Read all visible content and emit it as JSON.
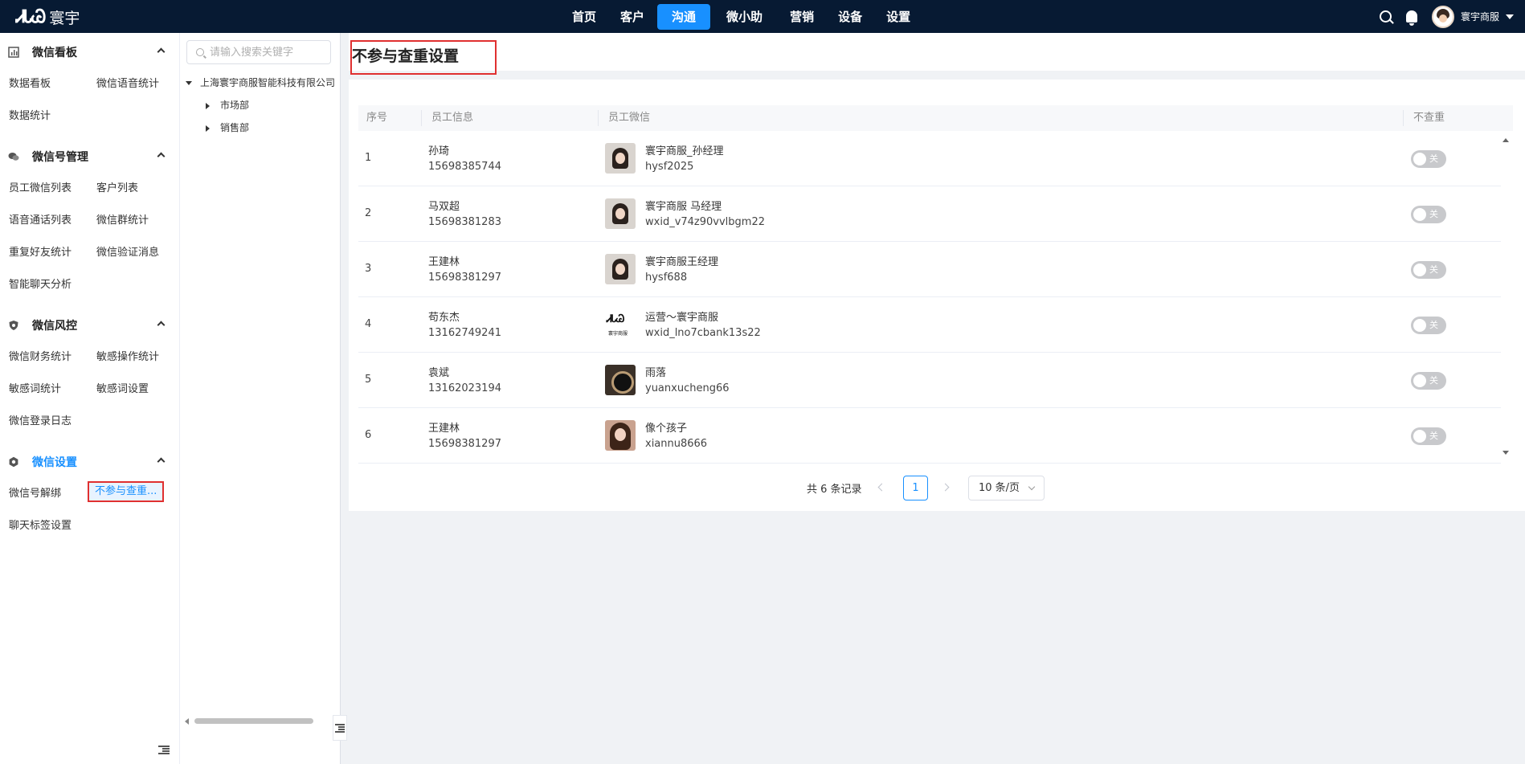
{
  "brand": {
    "mark": "ᏗᏓᏊ",
    "name": "寰宇"
  },
  "nav": [
    "首页",
    "客户",
    "沟通",
    "微小助",
    "营销",
    "设备",
    "设置"
  ],
  "nav_active": "沟通",
  "user": {
    "name": "寰宇商服"
  },
  "sidebar": {
    "groups": [
      {
        "title": "微信看板",
        "icon": "chart-icon",
        "items": [
          "数据看板",
          "微信语音统计",
          "数据统计"
        ]
      },
      {
        "title": "微信号管理",
        "icon": "chat-icon",
        "items": [
          "员工微信列表",
          "客户列表",
          "语音通话列表",
          "微信群统计",
          "重复好友统计",
          "微信验证消息",
          "智能聊天分析"
        ]
      },
      {
        "title": "微信风控",
        "icon": "shield-icon",
        "items": [
          "微信财务统计",
          "敏感操作统计",
          "敏感词统计",
          "敏感词设置",
          "微信登录日志"
        ]
      },
      {
        "title": "微信设置",
        "icon": "gear-icon",
        "items": [
          "微信号解绑",
          "不参与查重...",
          "聊天标签设置"
        ]
      }
    ]
  },
  "tree": {
    "search_placeholder": "请输入搜索关键字",
    "root": "上海寰宇商服智能科技有限公司",
    "children": [
      "市场部",
      "销售部"
    ]
  },
  "page_title": "不参与查重设置",
  "table": {
    "headers": [
      "序号",
      "员工信息",
      "员工微信",
      "不查重"
    ],
    "rows": [
      {
        "index": "1",
        "name": "孙琦",
        "phone": "15698385744",
        "wx_nick": "寰宇商服_孙经理",
        "wx_id": "hysf2025",
        "switch": "关",
        "on": false
      },
      {
        "index": "2",
        "name": "马双超",
        "phone": "15698381283",
        "wx_nick": "寰宇商服 马经理",
        "wx_id": "wxid_v74z90vvlbgm22",
        "switch": "关",
        "on": false
      },
      {
        "index": "3",
        "name": "王建林",
        "phone": "15698381297",
        "wx_nick": "寰宇商服王经理",
        "wx_id": "hysf688",
        "switch": "关",
        "on": false
      },
      {
        "index": "4",
        "name": "苟东杰",
        "phone": "13162749241",
        "wx_nick": "运营～寰宇商服",
        "wx_id": "wxid_lno7cbank13s22",
        "switch": "关",
        "on": false
      },
      {
        "index": "5",
        "name": "袁斌",
        "phone": "13162023194",
        "wx_nick": "雨落",
        "wx_id": "yuanxucheng66",
        "switch": "关",
        "on": false
      },
      {
        "index": "6",
        "name": "王建林",
        "phone": "15698381297",
        "wx_nick": "像个孩子",
        "wx_id": "xiannu8666",
        "switch": "关",
        "on": false
      }
    ]
  },
  "pagination": {
    "total": "共 6 条记录",
    "current": "1",
    "page_size": "10 条/页"
  },
  "logo_small": {
    "mark": "ᏗᏓᏊ",
    "text": "寰宇商服"
  },
  "colors": {
    "accent": "#1890ff",
    "topbar": "#071a33",
    "highlight": "#e03030",
    "switch_off": "#c8c9cc"
  }
}
